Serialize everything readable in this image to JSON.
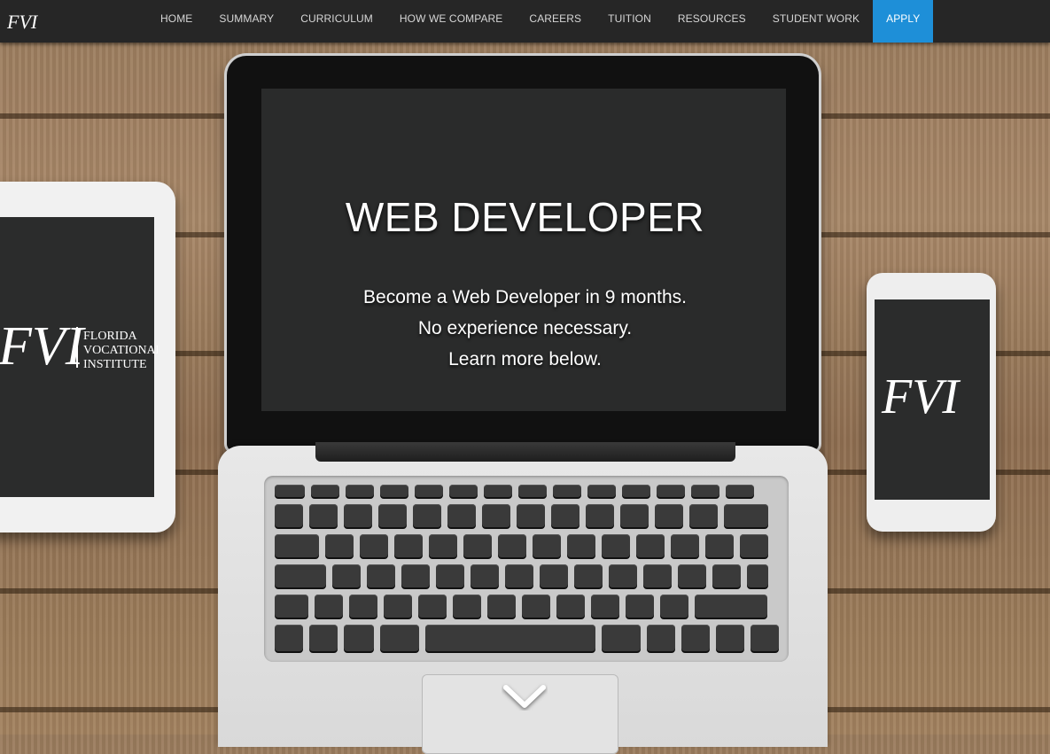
{
  "nav": {
    "items": [
      {
        "label": "HOME"
      },
      {
        "label": "SUMMARY"
      },
      {
        "label": "CURRICULUM"
      },
      {
        "label": "HOW WE COMPARE"
      },
      {
        "label": "CAREERS"
      },
      {
        "label": "TUITION"
      },
      {
        "label": "RESOURCES"
      },
      {
        "label": "STUDENT WORK"
      }
    ],
    "apply_label": "APPLY"
  },
  "hero": {
    "title": "WEB DEVELOPER",
    "lines": [
      "Become a Web Developer in 9 months.",
      "No experience necessary.",
      "Learn more below."
    ]
  },
  "brand": {
    "short": "FVI",
    "full_line1": "FLORIDA",
    "full_line2": "VOCATIONAL",
    "full_line3": "INSTITUTE"
  },
  "colors": {
    "nav_bg": "#262626",
    "apply_bg": "#1e8fd8",
    "nav_text": "#d6d6d6"
  }
}
